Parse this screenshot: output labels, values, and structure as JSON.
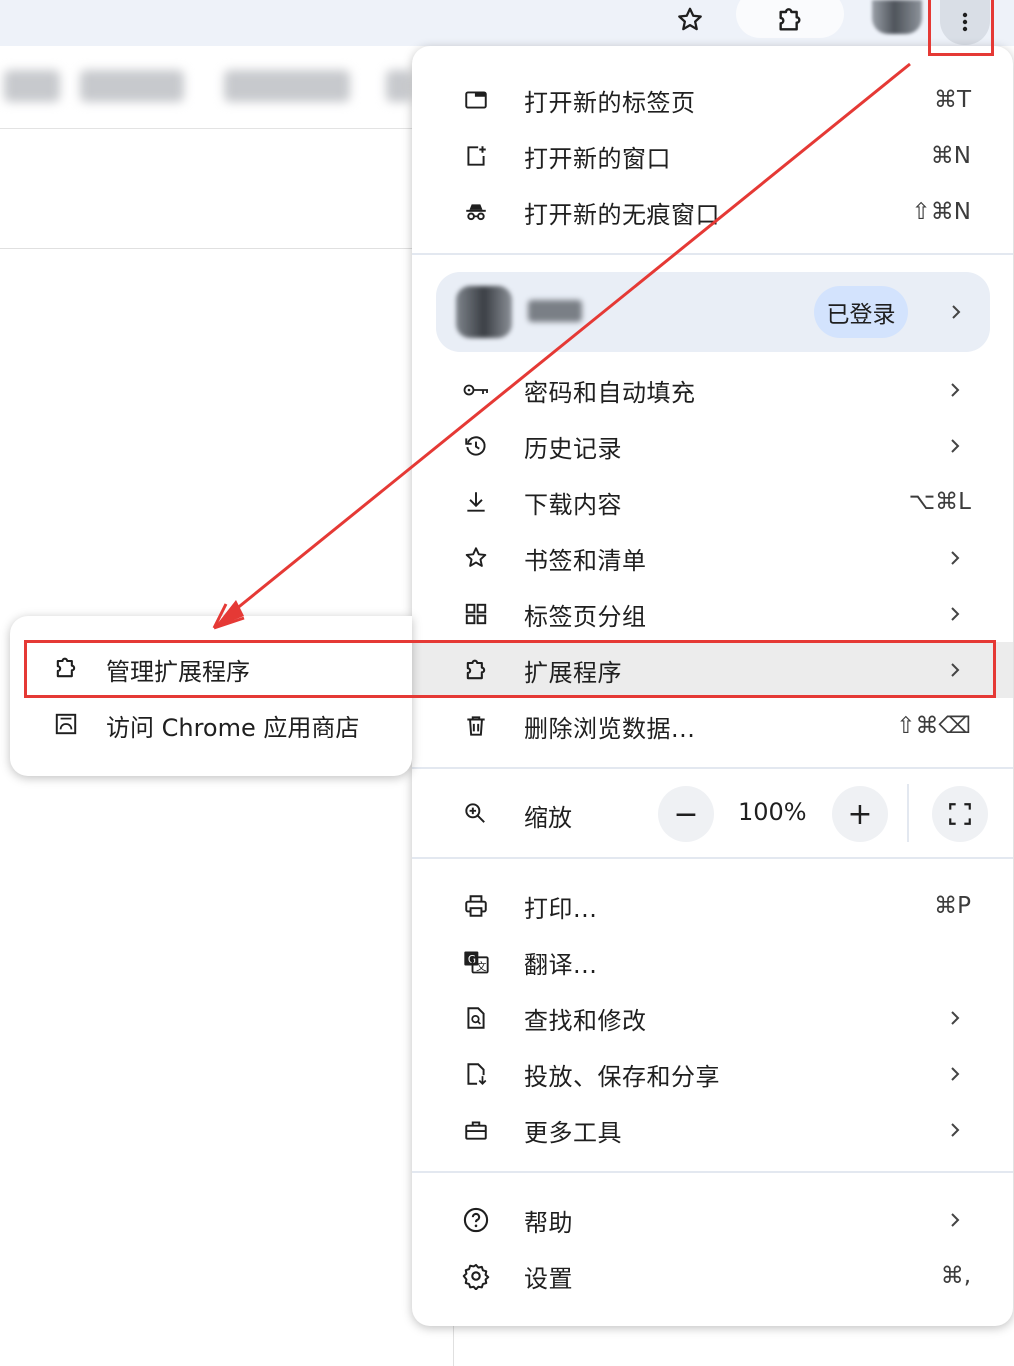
{
  "toolbar": {
    "icons": [
      "star-icon",
      "extensions-puzzle-icon",
      "profile-avatar",
      "more-vert-icon"
    ]
  },
  "menu": {
    "items_top": [
      {
        "label": "打开新的标签页",
        "shortcut": "⌘T",
        "icon": "new-tab-icon"
      },
      {
        "label": "打开新的窗口",
        "shortcut": "⌘N",
        "icon": "new-window-icon"
      },
      {
        "label": "打开新的无痕窗口",
        "shortcut": "⇧⌘N",
        "icon": "incognito-icon"
      }
    ],
    "profile": {
      "status": "已登录"
    },
    "items_mid": [
      {
        "label": "密码和自动填充",
        "icon": "key-icon",
        "submenu": true
      },
      {
        "label": "历史记录",
        "icon": "history-icon",
        "submenu": true
      },
      {
        "label": "下载内容",
        "shortcut": "⌥⌘L",
        "icon": "download-icon"
      },
      {
        "label": "书签和清单",
        "icon": "star-icon",
        "submenu": true
      },
      {
        "label": "标签页分组",
        "icon": "tab-groups-icon",
        "submenu": true
      },
      {
        "label": "扩展程序",
        "icon": "extensions-puzzle-icon",
        "submenu": true
      },
      {
        "label": "删除浏览数据...",
        "shortcut": "⇧⌘⌫",
        "icon": "trash-icon"
      }
    ],
    "zoom": {
      "label": "缩放",
      "minus": "−",
      "value": "100%",
      "plus": "+"
    },
    "items_tools": [
      {
        "label": "打印...",
        "shortcut": "⌘P",
        "icon": "print-icon"
      },
      {
        "label": "翻译...",
        "icon": "translate-icon"
      },
      {
        "label": "查找和修改",
        "icon": "find-icon",
        "submenu": true
      },
      {
        "label": "投放、保存和分享",
        "icon": "cast-save-share-icon",
        "submenu": true
      },
      {
        "label": "更多工具",
        "icon": "toolbox-icon",
        "submenu": true
      }
    ],
    "items_bottom": [
      {
        "label": "帮助",
        "icon": "help-icon",
        "submenu": true
      },
      {
        "label": "设置",
        "shortcut": "⌘,",
        "icon": "settings-icon"
      }
    ]
  },
  "submenu": {
    "items": [
      {
        "label": "管理扩展程序",
        "icon": "extensions-puzzle-icon"
      },
      {
        "label": "访问 Chrome 应用商店",
        "icon": "web-store-icon"
      }
    ]
  },
  "annotation_color": "#e53935"
}
